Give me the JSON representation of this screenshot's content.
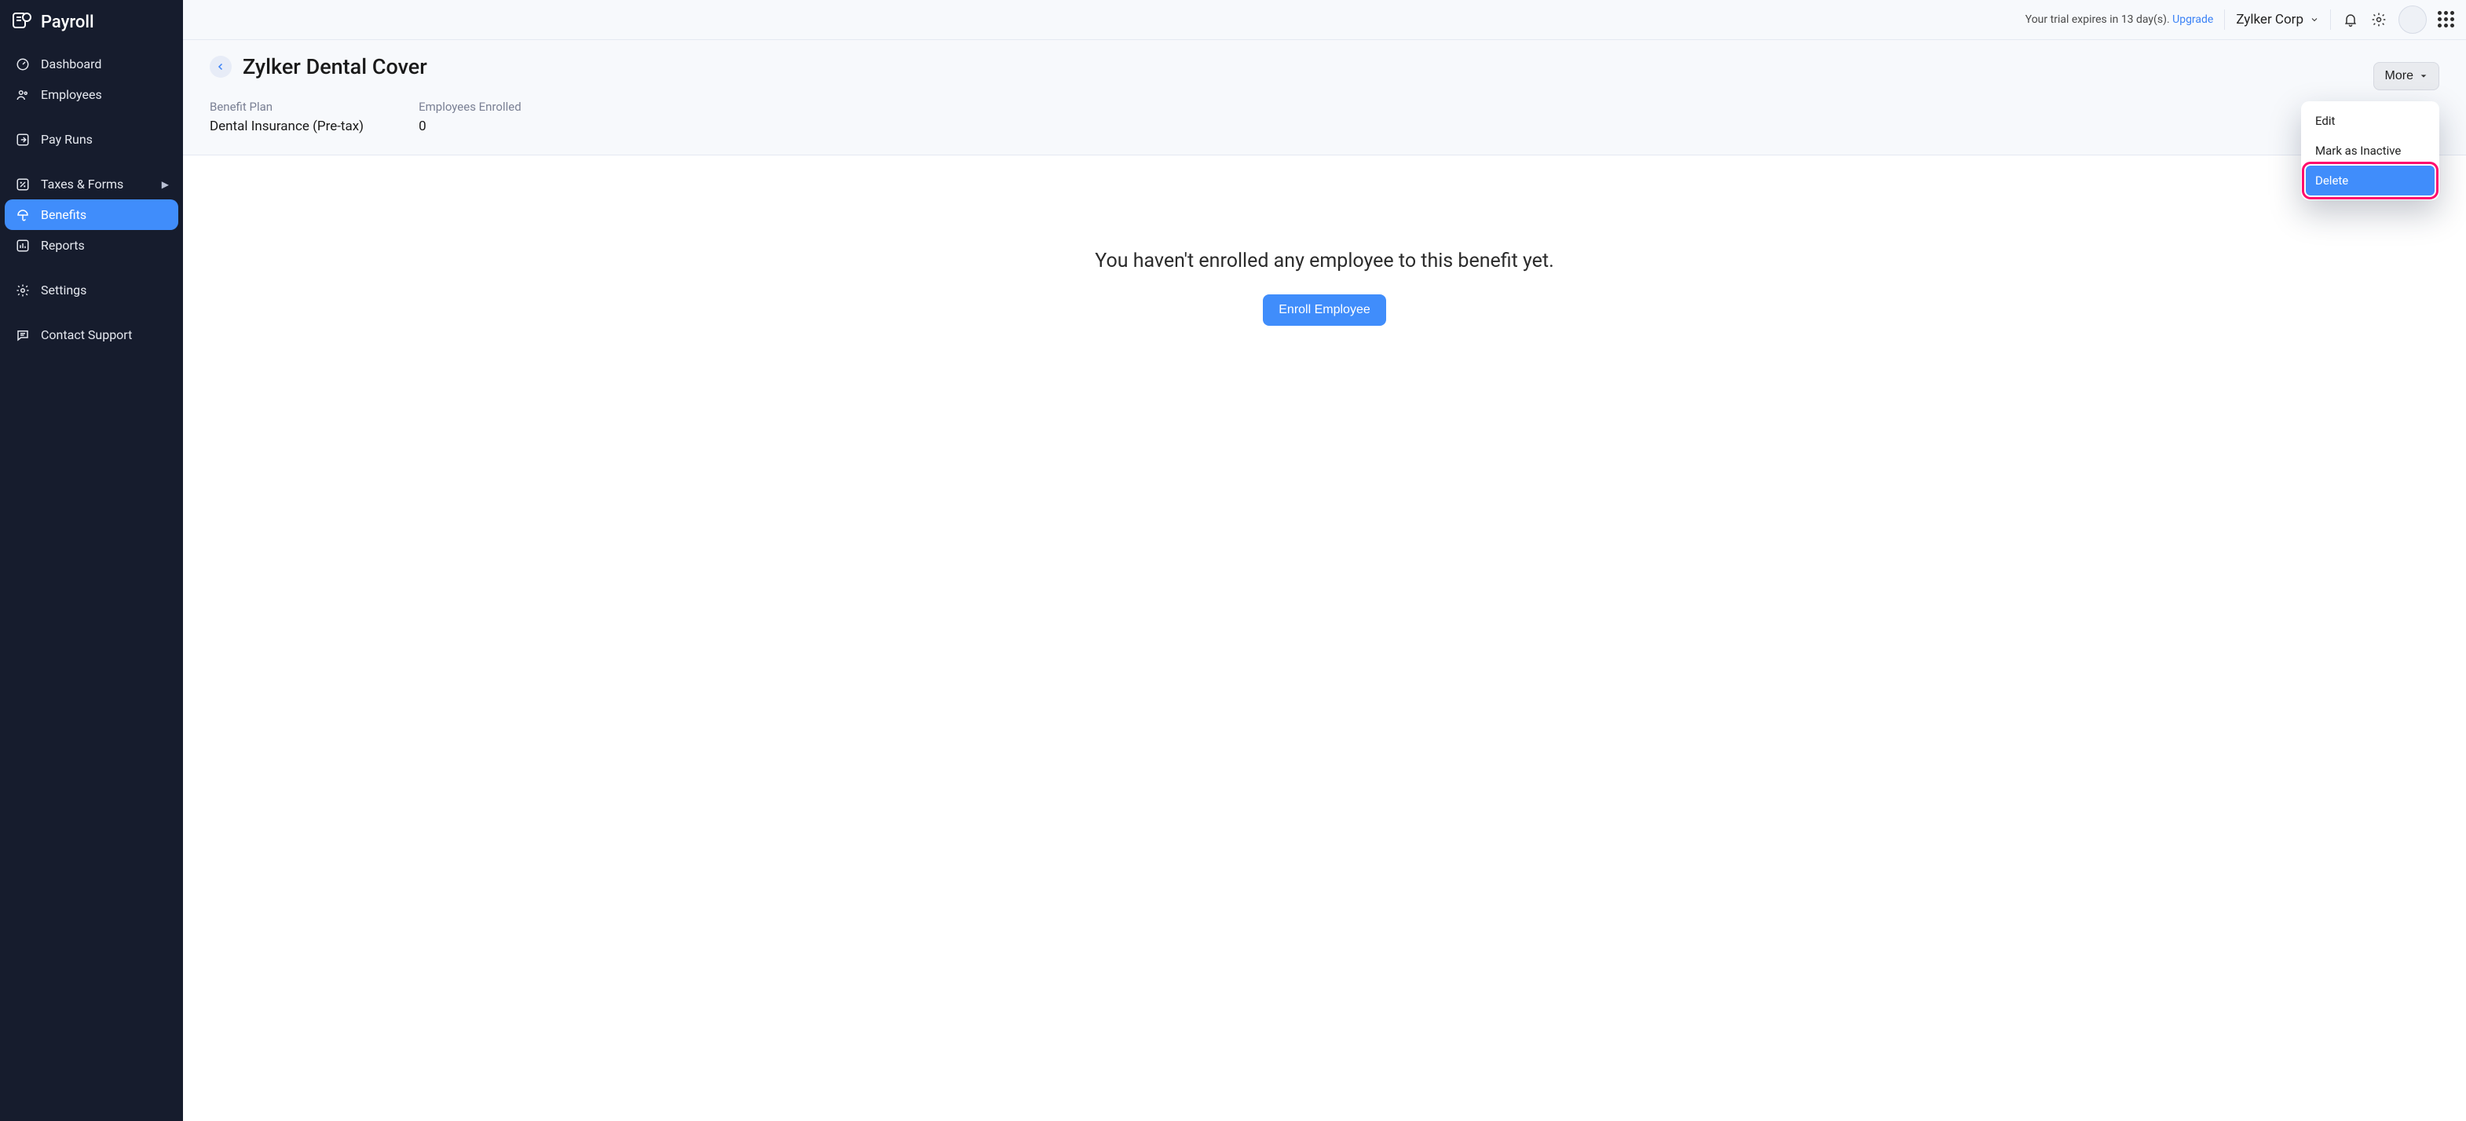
{
  "brand": {
    "name": "Payroll"
  },
  "sidebar": {
    "items": [
      {
        "label": "Dashboard"
      },
      {
        "label": "Employees"
      },
      {
        "label": "Pay Runs"
      },
      {
        "label": "Taxes & Forms"
      },
      {
        "label": "Benefits"
      },
      {
        "label": "Reports"
      },
      {
        "label": "Settings"
      },
      {
        "label": "Contact Support"
      }
    ]
  },
  "topbar": {
    "trial_text": "Your trial expires in 13 day(s). ",
    "trial_link": "Upgrade",
    "org_name": "Zylker Corp"
  },
  "page": {
    "title": "Zylker Dental Cover",
    "more_label": "More",
    "meta": {
      "plan_label": "Benefit Plan",
      "plan_value": "Dental Insurance (Pre-tax)",
      "enrolled_label": "Employees Enrolled",
      "enrolled_value": "0"
    },
    "empty_message": "You haven't enrolled any employee to this benefit yet.",
    "enroll_button": "Enroll Employee"
  },
  "dropdown": {
    "items": [
      {
        "label": "Edit"
      },
      {
        "label": "Mark as Inactive"
      },
      {
        "label": "Delete"
      }
    ]
  }
}
